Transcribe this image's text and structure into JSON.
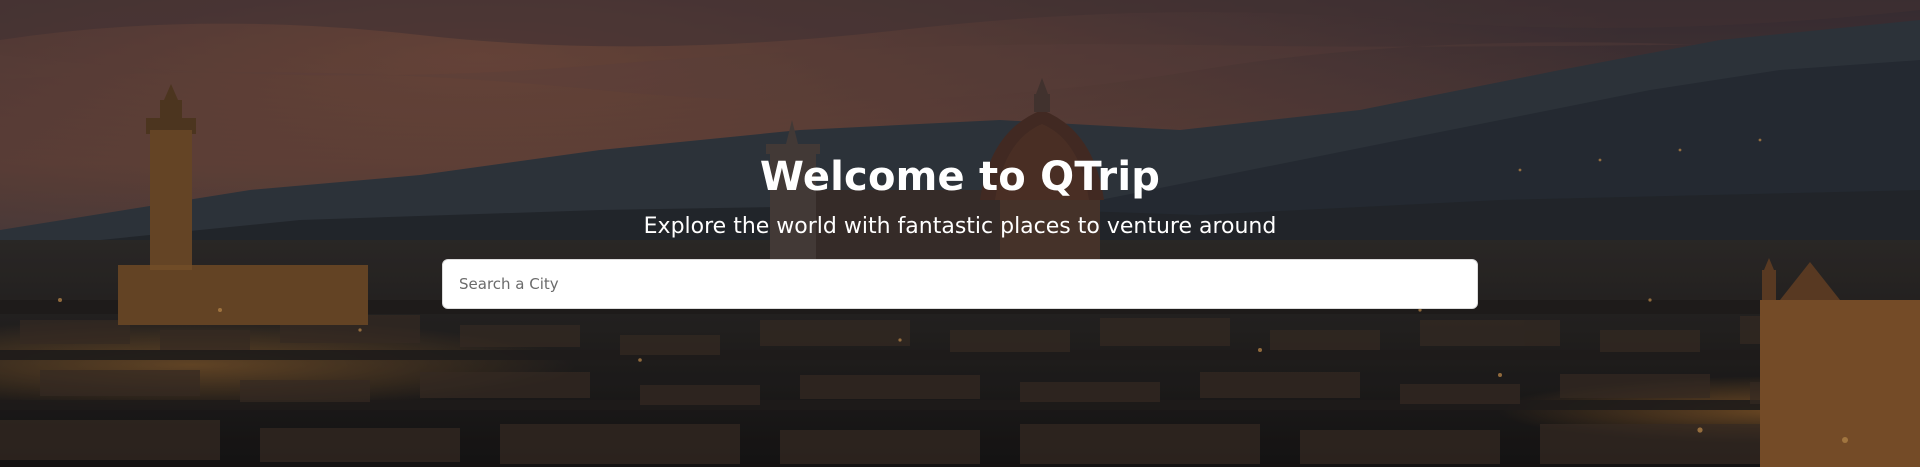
{
  "hero": {
    "title": "Welcome to QTrip",
    "subtitle": "Explore the world with fantastic places to venture around",
    "search": {
      "placeholder": "Search a City",
      "value": ""
    }
  },
  "colors": {
    "sky_top": "#4a3d43",
    "sky_glow": "#8a5a4a",
    "mountains": "#3d4652",
    "city_dark": "#1f1d1c",
    "warm_light": "#d98a3a",
    "text": "#ffffff",
    "search_bg": "#ffffff"
  }
}
